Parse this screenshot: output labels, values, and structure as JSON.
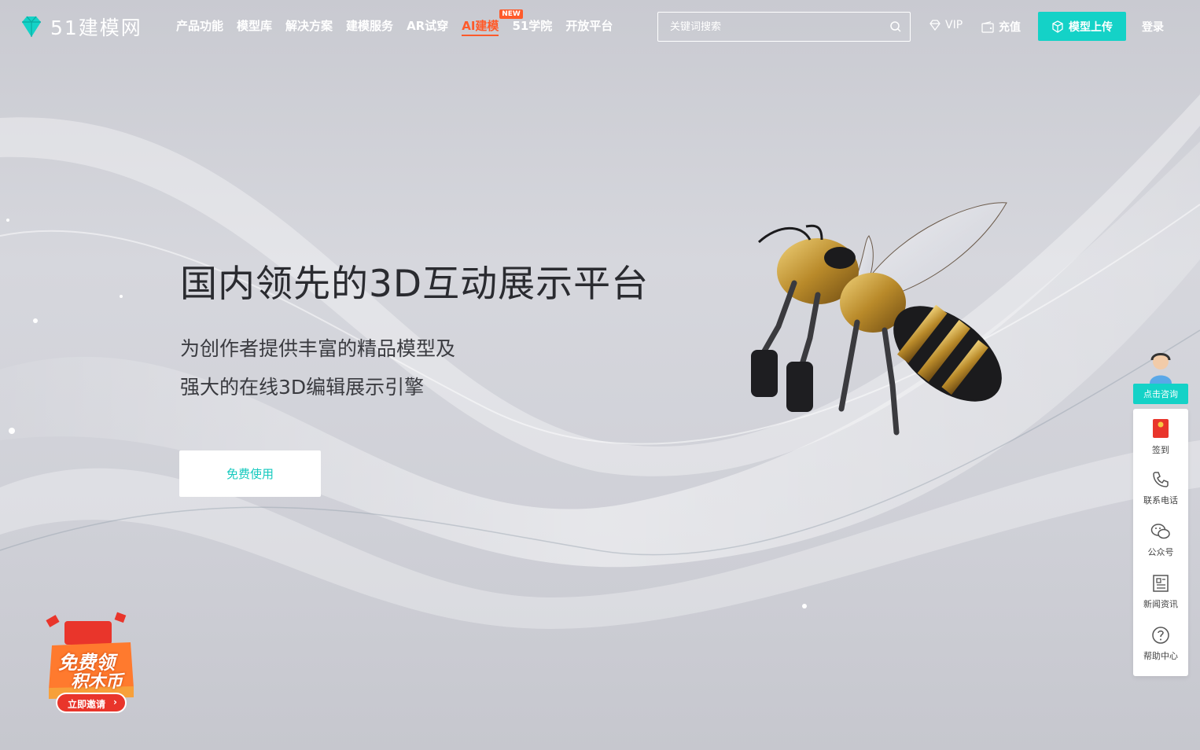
{
  "header": {
    "logo_text": "51建模网",
    "nav": [
      {
        "label": "产品功能"
      },
      {
        "label": "模型库"
      },
      {
        "label": "解决方案"
      },
      {
        "label": "建模服务"
      },
      {
        "label": "AR试穿"
      },
      {
        "label": "AI建模",
        "badge": "NEW"
      },
      {
        "label": "51学院"
      },
      {
        "label": "开放平台"
      }
    ],
    "search_placeholder": "关键词搜索",
    "vip_label": "VIP",
    "recharge_label": "充值",
    "upload_label": "模型上传",
    "login_label": "登录"
  },
  "hero": {
    "title": "国内领先的3D互动展示平台",
    "subtitle_line1": "为创作者提供丰富的精品模型及",
    "subtitle_line2": "强大的在线3D编辑展示引擎",
    "cta_label": "免费使用"
  },
  "sidebar": {
    "consult_label": "点击咨询",
    "items": [
      {
        "label": "签到",
        "icon": "red-envelope-icon"
      },
      {
        "label": "联系电话",
        "icon": "phone-icon"
      },
      {
        "label": "公众号",
        "icon": "wechat-icon"
      },
      {
        "label": "新闻资讯",
        "icon": "news-icon"
      },
      {
        "label": "帮助中心",
        "icon": "help-icon"
      }
    ]
  },
  "promo": {
    "line1": "免费领",
    "line2": "积木币",
    "button": "立即邀请"
  },
  "colors": {
    "accent": "#14d2c7",
    "active_nav": "#ff5a2a"
  }
}
